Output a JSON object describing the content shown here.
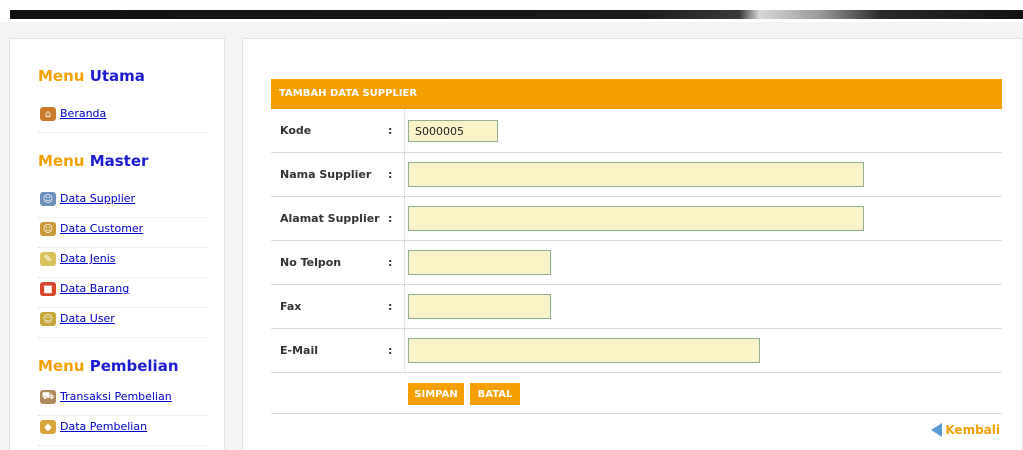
{
  "sidebar": {
    "menu_utama": {
      "prefix": "Menu",
      "highlight": "Utama"
    },
    "menu_master": {
      "prefix": "Menu",
      "highlight": "Master"
    },
    "menu_pembelian": {
      "prefix": "Menu",
      "highlight": "Pembelian"
    },
    "items": [
      {
        "label": "Beranda",
        "icon": "home-icon"
      },
      {
        "label": "Data Supplier",
        "icon": "users-icon"
      },
      {
        "label": "Data Customer",
        "icon": "customer-icon"
      },
      {
        "label": "Data Jenis",
        "icon": "notepad-icon"
      },
      {
        "label": "Data Barang",
        "icon": "box-icon"
      },
      {
        "label": "Data User",
        "icon": "group-icon"
      },
      {
        "label": "Transaksi Pembelian",
        "icon": "cart-icon"
      },
      {
        "label": "Data Pembelian",
        "icon": "bag-icon"
      }
    ]
  },
  "form": {
    "title": "TAMBAH DATA SUPPLIER",
    "colon": ":",
    "fields": [
      {
        "label": "Kode",
        "value": "S000005"
      },
      {
        "label": "Nama Supplier",
        "value": ""
      },
      {
        "label": "Alamat Supplier",
        "value": ""
      },
      {
        "label": "No Telpon",
        "value": ""
      },
      {
        "label": "Fax",
        "value": ""
      },
      {
        "label": "E-Mail",
        "value": ""
      }
    ],
    "save_label": "SIMPAN",
    "cancel_label": "BATAL"
  },
  "back_label": "Kembali",
  "colors": {
    "accent": "#f5a000",
    "menu_highlight": "#1d1dcf",
    "field_bg": "#fbf3c8",
    "link": "#0000cc"
  }
}
